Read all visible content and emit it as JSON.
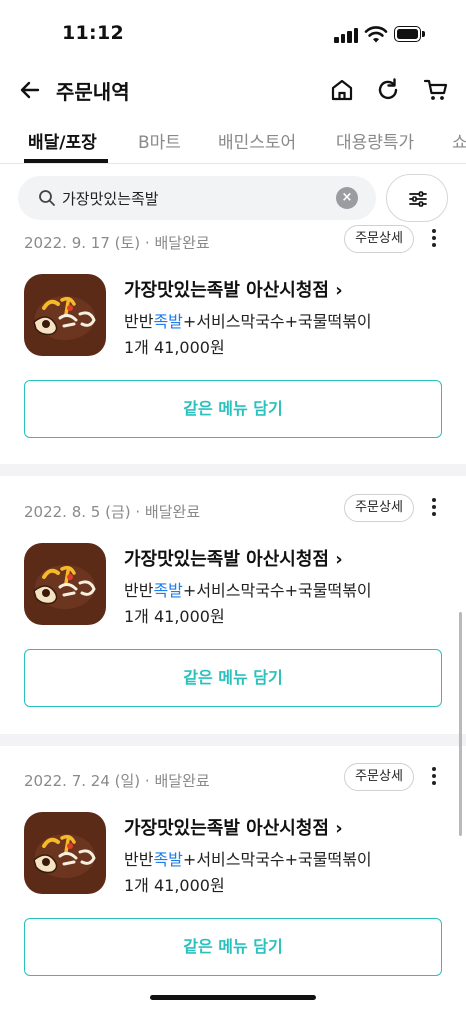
{
  "status_bar": {
    "time": "11:12"
  },
  "header": {
    "title": "주문내역"
  },
  "tabs": [
    {
      "label": "배달/포장"
    },
    {
      "label": "B마트"
    },
    {
      "label": "배민스토어"
    },
    {
      "label": "대용량특가"
    },
    {
      "label": "쇼"
    }
  ],
  "search": {
    "value": "가장맛있는족발",
    "clear_label": "×"
  },
  "orders": [
    {
      "date": "2022. 9. 17 (토)",
      "status": "배달완료",
      "detail_label": "주문상세",
      "store_name": "가장맛있는족발 아산시청점",
      "menu_prefix": "반반",
      "menu_highlight": "족발",
      "menu_suffix": "+서비스막국수+국물떡볶이",
      "price_line": "1개 41,000원",
      "reorder_label": "같은 메뉴 담기"
    },
    {
      "date": "2022. 8. 5 (금)",
      "status": "배달완료",
      "detail_label": "주문상세",
      "store_name": "가장맛있는족발 아산시청점",
      "menu_prefix": "반반",
      "menu_highlight": "족발",
      "menu_suffix": "+서비스막국수+국물떡볶이",
      "price_line": "1개 41,000원",
      "reorder_label": "같은 메뉴 담기"
    },
    {
      "date": "2022. 7. 24 (일)",
      "status": "배달완료",
      "detail_label": "주문상세",
      "store_name": "가장맛있는족발 아산시청점",
      "menu_prefix": "반반",
      "menu_highlight": "족발",
      "menu_suffix": "+서비스막국수+국물떡볶이",
      "price_line": "1개 41,000원",
      "reorder_label": "같은 메뉴 담기"
    }
  ],
  "icons": {
    "back": "arrow-left-icon",
    "home": "home-icon",
    "refresh": "refresh-icon",
    "cart": "cart-icon",
    "search": "search-icon",
    "filter": "sliders-icon",
    "more": "more-vertical-icon"
  },
  "colors": {
    "accent": "#2ac1bc",
    "highlight": "#1f7ce8",
    "logo_bg": "#5c2b17"
  }
}
